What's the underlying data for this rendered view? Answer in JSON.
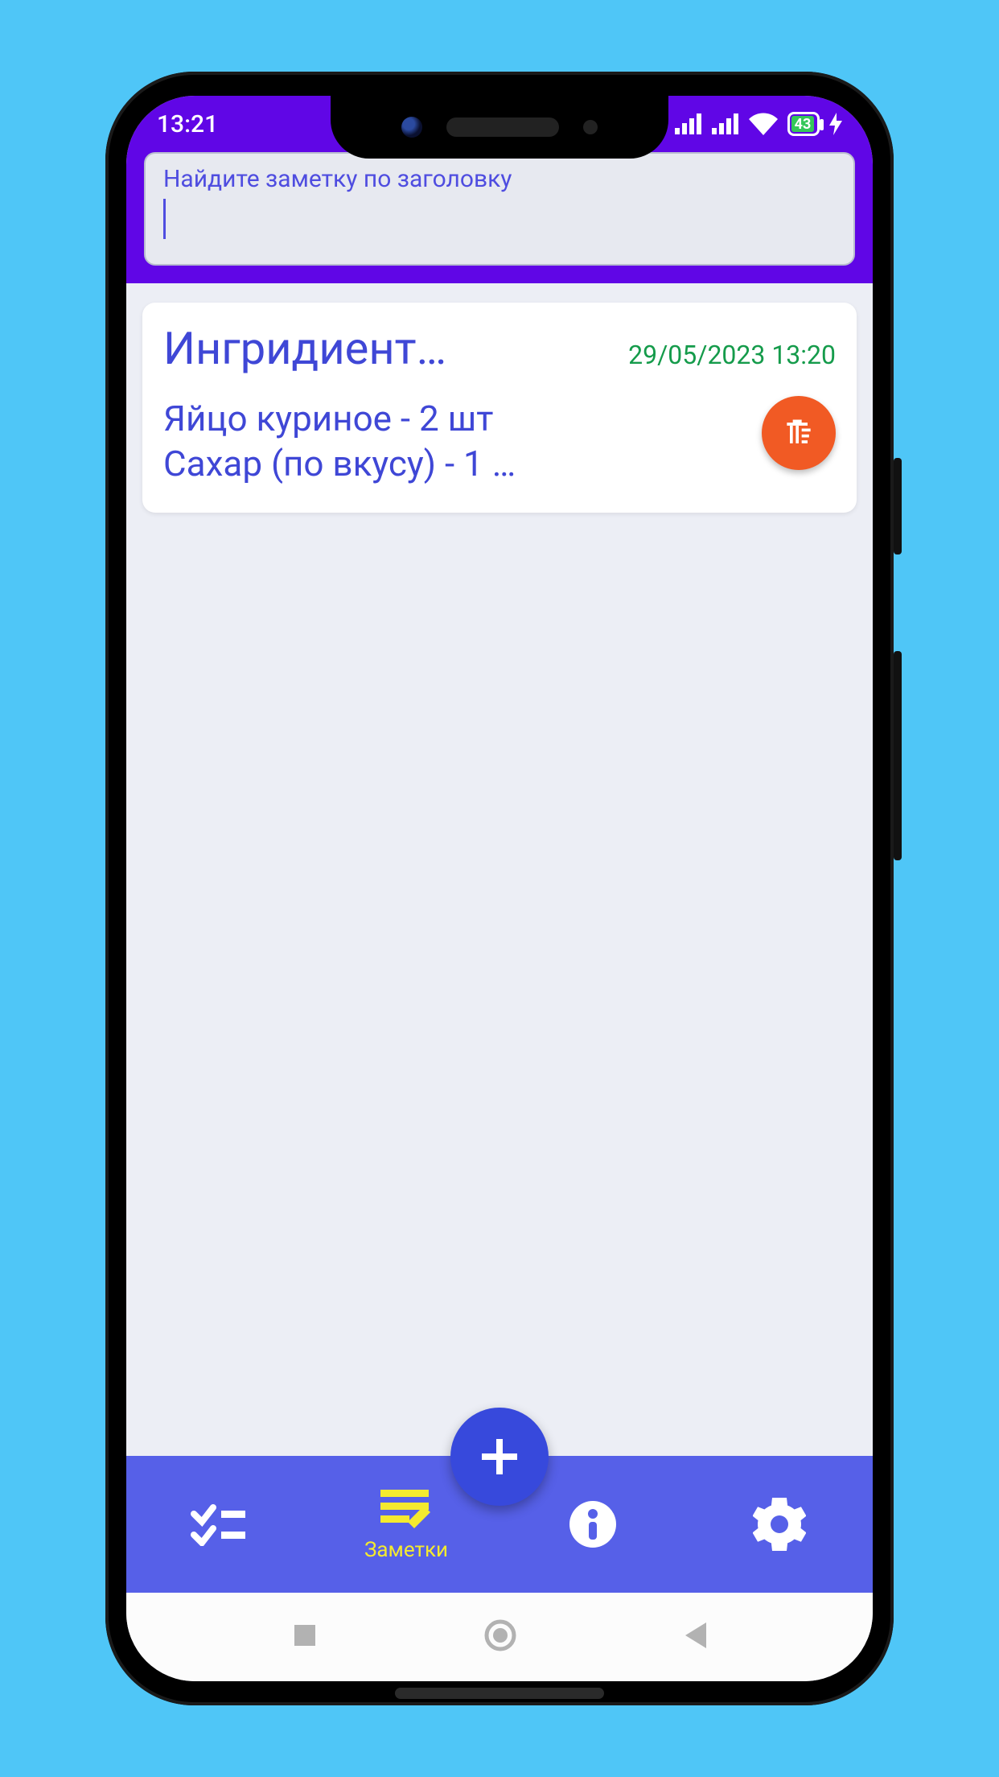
{
  "status": {
    "time": "13:21",
    "battery_pct": "43"
  },
  "search": {
    "label": "Найдите заметку по заголовку",
    "value": ""
  },
  "notes": [
    {
      "title": "Ингридиент…",
      "timestamp": "29/05/2023 13:20",
      "body": "Яйцо куриное  - 2 шт\nСахар (по вкусу) - 1 …"
    }
  ],
  "nav": {
    "tab_notes_label": "Заметки"
  }
}
